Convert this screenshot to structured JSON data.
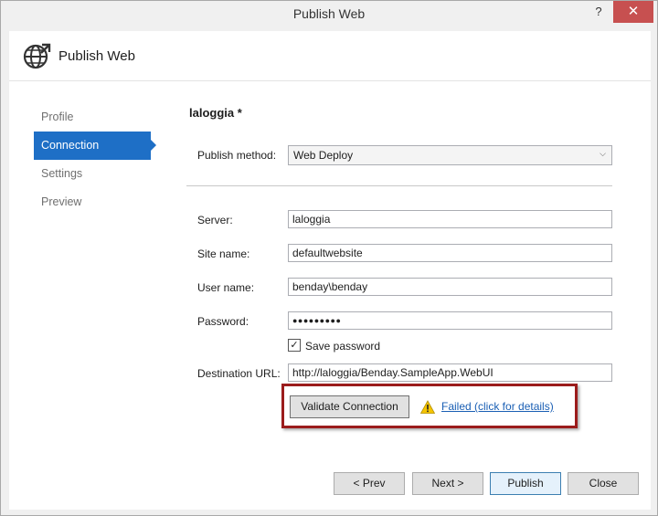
{
  "window": {
    "title": "Publish Web",
    "help_glyph": "?",
    "close_glyph": "✕"
  },
  "header": {
    "title": "Publish Web",
    "icon": "globe-publish-icon"
  },
  "nav": {
    "items": [
      {
        "label": "Profile"
      },
      {
        "label": "Connection"
      },
      {
        "label": "Settings"
      },
      {
        "label": "Preview"
      }
    ],
    "active_index": 1
  },
  "profile": {
    "name": "laloggia *"
  },
  "form": {
    "publish_method": {
      "label": "Publish method:",
      "value": "Web Deploy"
    },
    "server": {
      "label": "Server:",
      "value": "laloggia"
    },
    "site_name": {
      "label": "Site name:",
      "value": "defaultwebsite"
    },
    "user_name": {
      "label": "User name:",
      "value": "benday\\benday"
    },
    "password": {
      "label": "Password:",
      "value": "●●●●●●●●●"
    },
    "save_password": {
      "label": "Save password",
      "checked": true
    },
    "destination_url": {
      "label": "Destination URL:",
      "value": "http://laloggia/Benday.SampleApp.WebUI"
    }
  },
  "validation": {
    "button_label": "Validate Connection",
    "status_icon": "warning-icon",
    "status_link": "Failed (click for details)",
    "highlight_color": "#9b1c1c"
  },
  "footer": {
    "prev_label": "< Prev",
    "next_label": "Next >",
    "publish_label": "Publish",
    "close_label": "Close"
  },
  "colors": {
    "accent": "#1e6fc6",
    "link": "#1a5fb4",
    "close": "#c75050"
  }
}
